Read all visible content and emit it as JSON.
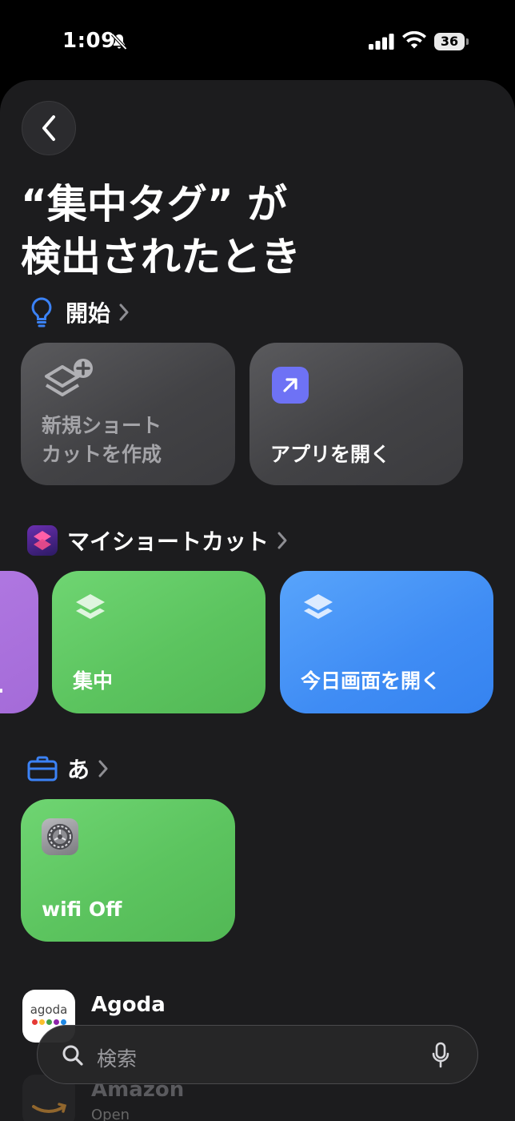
{
  "status": {
    "time": "1:09",
    "battery": "36"
  },
  "title_line1": "“集中タグ” が",
  "title_line2": "検出されたとき",
  "sections": {
    "start": {
      "label": "開始"
    },
    "my_shortcuts": {
      "label": "マイショートカット"
    },
    "a": {
      "label": "あ"
    }
  },
  "start_cards": {
    "new_shortcut": {
      "line1": "新規ショート",
      "line2": "カットを作成"
    },
    "open_app": {
      "label": "アプリを開く"
    }
  },
  "my_cards": {
    "partial": {
      "label": "."
    },
    "focus": {
      "label": "集中"
    },
    "today": {
      "label": "今日画面を開く"
    }
  },
  "a_cards": {
    "wifi": {
      "label": "wifi Off"
    }
  },
  "apps": [
    {
      "name": "Agoda",
      "icon_text": "agoda"
    },
    {
      "name": "Amazon",
      "subtitle": "Open Amazon"
    }
  ],
  "search": {
    "placeholder": "検索"
  },
  "colors": {
    "accent_blue": "#3b82f6",
    "green_card": "#5cc45f",
    "blue_card": "#3f8cf4"
  }
}
